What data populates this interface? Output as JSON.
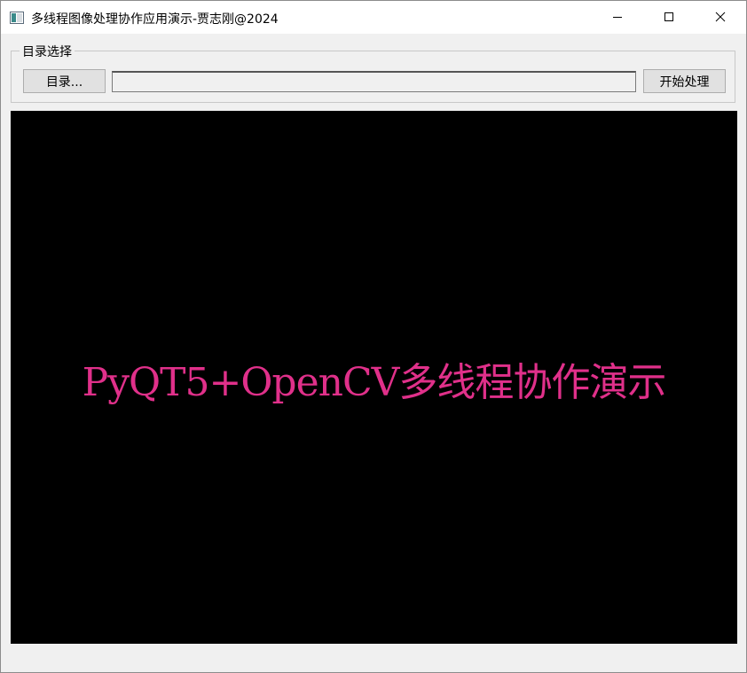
{
  "window": {
    "title": "多线程图像处理协作应用演示-贾志刚@2024"
  },
  "group": {
    "title": "目录选择",
    "dir_button": "目录...",
    "path_value": "",
    "start_button": "开始处理"
  },
  "display": {
    "text": "PyQT5+OpenCV多线程协作演示",
    "text_color": "#e0308a",
    "background": "#000000"
  },
  "icons": {
    "app": "app-window-icon",
    "minimize": "minimize-icon",
    "maximize": "maximize-icon",
    "close": "close-icon"
  }
}
